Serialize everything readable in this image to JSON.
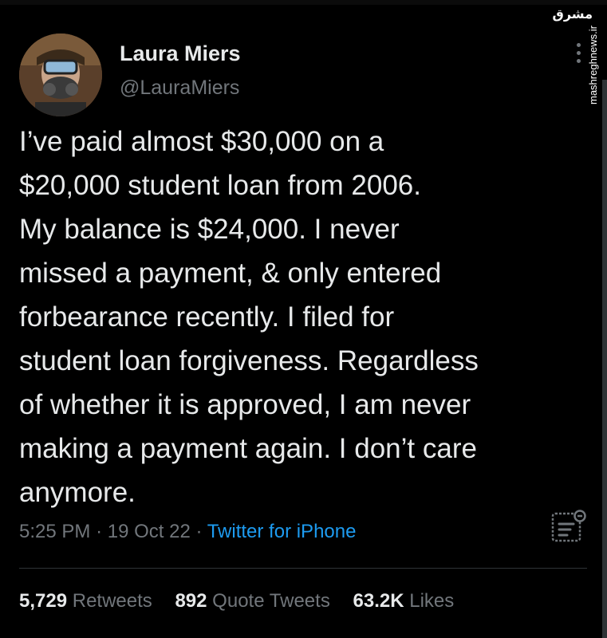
{
  "author": {
    "display_name": "Laura Miers",
    "handle": "@LauraMiers"
  },
  "watermark": {
    "logo_text": "مشرق",
    "site": "mashreghnews.ir"
  },
  "tweet": {
    "lines": [
      "I’ve paid almost $30,000 on a",
      "$20,000 student loan from 2006.",
      "My balance is $24,000. I never",
      "missed a payment, & only entered",
      "forbearance recently. I filed for",
      "student loan forgiveness. Regardless",
      "of whether it is approved, I am never",
      "making a payment again. I don’t care",
      "anymore."
    ],
    "time": "5:25 PM",
    "date": "19 Oct 22",
    "separator": "·",
    "source": "Twitter for iPhone"
  },
  "stats": {
    "retweets_count": "5,729",
    "retweets_label": "Retweets",
    "quotes_count": "892",
    "quotes_label": "Quote Tweets",
    "likes_count": "63.2K",
    "likes_label": "Likes"
  },
  "icons": {
    "more": "more-icon",
    "analytics": "analytics-icon"
  },
  "colors": {
    "background": "#000000",
    "text": "#e7e9ea",
    "secondary": "#71767b",
    "link": "#1d9bf0"
  }
}
